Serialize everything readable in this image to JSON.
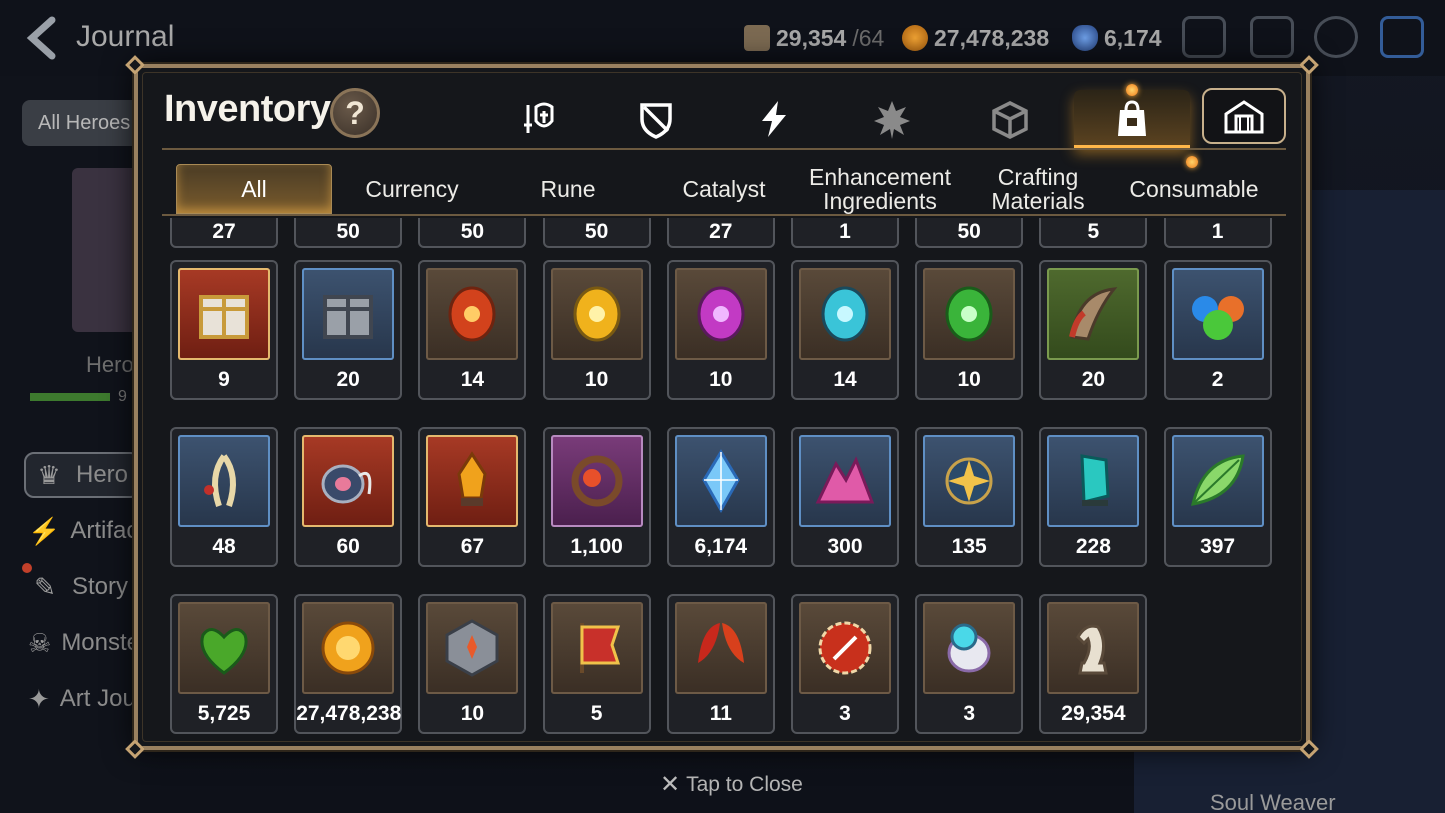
{
  "header": {
    "title": "Journal",
    "resources": [
      {
        "icon": "stamina-icon",
        "value": "29,354",
        "max": "/64",
        "color": "#a08a6a"
      },
      {
        "icon": "gold-icon",
        "value": "27,478,238",
        "color": "#d48a22"
      },
      {
        "icon": "skystone-icon",
        "value": "6,174",
        "color": "#4c7ec8"
      }
    ]
  },
  "sidebar": {
    "filter_label": "All Heroes",
    "hero_label": "Hero",
    "hero_bar_text": "9",
    "menu": [
      {
        "label": "Hero",
        "icon": "hero-icon",
        "active": true
      },
      {
        "label": "Artifact",
        "icon": "artifact-icon"
      },
      {
        "label": "Story",
        "icon": "story-icon"
      },
      {
        "label": "Monster",
        "icon": "monster-icon"
      },
      {
        "label": "Art Journal",
        "icon": "art-journal-icon"
      }
    ]
  },
  "right_panel": {
    "soul_weaver": "Soul Weaver"
  },
  "modal": {
    "title": "Inventory",
    "help": "?",
    "category_tabs": [
      {
        "icon": "equipment-icon",
        "active": false
      },
      {
        "icon": "artifact-shield-icon",
        "active": false
      },
      {
        "icon": "lightning-icon",
        "active": false
      },
      {
        "icon": "spirit-icon",
        "active": false
      },
      {
        "icon": "cube-icon",
        "active": false
      },
      {
        "icon": "bag-icon",
        "active": true
      },
      {
        "icon": "storage-icon",
        "active": false
      }
    ],
    "filter_tabs": [
      {
        "label": "All",
        "active": true
      },
      {
        "label": "Currency"
      },
      {
        "label": "Rune"
      },
      {
        "label": "Catalyst"
      },
      {
        "label": "Enhancement Ingredients"
      },
      {
        "label": "Crafting Materials"
      },
      {
        "label": "Consumable"
      }
    ],
    "partial_row": [
      "27",
      "50",
      "50",
      "50",
      "27",
      "1",
      "50",
      "5",
      "1"
    ],
    "items": [
      {
        "icon": "gold-box-icon",
        "qty": "9",
        "frame": "red"
      },
      {
        "icon": "silver-box-icon",
        "qty": "20",
        "frame": "blue"
      },
      {
        "icon": "red-rune-icon",
        "qty": "14",
        "frame": "brown"
      },
      {
        "icon": "gold-rune-icon",
        "qty": "10",
        "frame": "brown"
      },
      {
        "icon": "purple-rune-icon",
        "qty": "10",
        "frame": "brown"
      },
      {
        "icon": "blue-rune-icon",
        "qty": "14",
        "frame": "brown"
      },
      {
        "icon": "green-rune-icon",
        "qty": "10",
        "frame": "brown"
      },
      {
        "icon": "claw-icon",
        "qty": "20",
        "frame": "green"
      },
      {
        "icon": "orbs-icon",
        "qty": "2",
        "frame": "blue"
      },
      {
        "icon": "root-icon",
        "qty": "48",
        "frame": "blue"
      },
      {
        "icon": "charm-icon",
        "qty": "60",
        "frame": "red"
      },
      {
        "icon": "crystal-flame-icon",
        "qty": "67",
        "frame": "red"
      },
      {
        "icon": "ring-icon",
        "qty": "1,100",
        "frame": "purple"
      },
      {
        "icon": "skystone-gem-icon",
        "qty": "6,174",
        "frame": "blue"
      },
      {
        "icon": "pink-crystal-icon",
        "qty": "300",
        "frame": "blue"
      },
      {
        "icon": "star-charm-icon",
        "qty": "135",
        "frame": "blue"
      },
      {
        "icon": "teal-crystal-icon",
        "qty": "228",
        "frame": "blue"
      },
      {
        "icon": "leaf-icon",
        "qty": "397",
        "frame": "blue"
      },
      {
        "icon": "heart-leaf-icon",
        "qty": "5,725",
        "frame": "brown"
      },
      {
        "icon": "gold-coin-icon",
        "qty": "27,478,238",
        "frame": "brown"
      },
      {
        "icon": "stone-cube-icon",
        "qty": "10",
        "frame": "brown"
      },
      {
        "icon": "banner-icon",
        "qty": "5",
        "frame": "brown"
      },
      {
        "icon": "red-leaves-icon",
        "qty": "11",
        "frame": "brown"
      },
      {
        "icon": "red-badge-icon",
        "qty": "3",
        "frame": "brown"
      },
      {
        "icon": "robot-pet-icon",
        "qty": "3",
        "frame": "brown"
      },
      {
        "icon": "chess-knight-icon",
        "qty": "29,354",
        "frame": "brown"
      }
    ],
    "close_hint": "Tap to Close"
  }
}
